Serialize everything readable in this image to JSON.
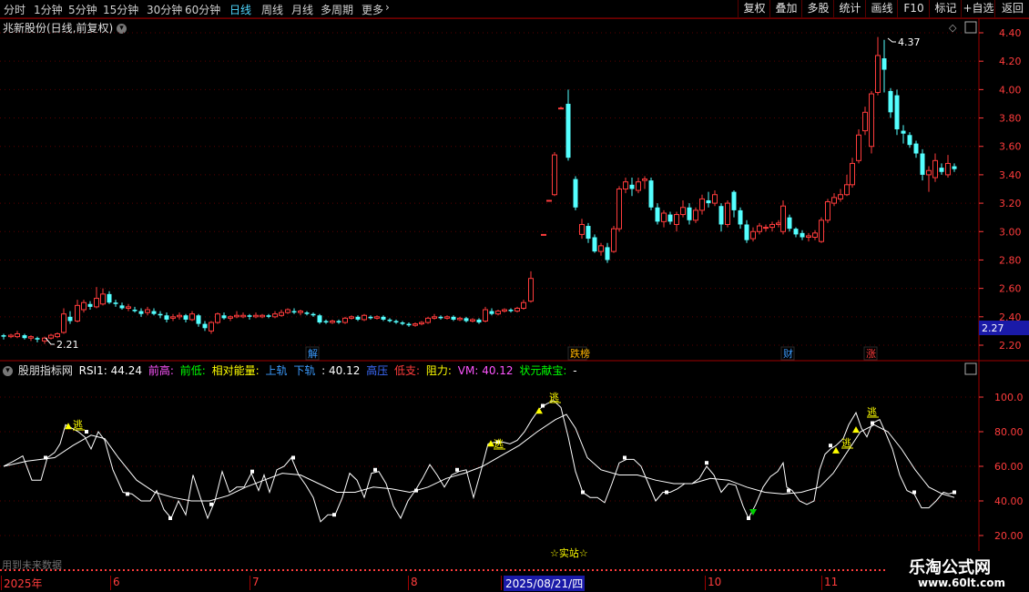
{
  "topbar": {
    "tabs": [
      {
        "label": "分时",
        "active": false
      },
      {
        "label": "1分钟",
        "active": false
      },
      {
        "label": "5分钟",
        "active": false
      },
      {
        "label": "15分钟",
        "active": false
      },
      {
        "label": "30分钟",
        "active": false
      },
      {
        "label": "60分钟",
        "active": false
      },
      {
        "label": "日线",
        "active": true
      },
      {
        "label": "周线",
        "active": false
      },
      {
        "label": "月线",
        "active": false
      },
      {
        "label": "多周期",
        "active": false
      },
      {
        "label": "更多",
        "active": false
      }
    ],
    "buttons": [
      "复权",
      "叠加",
      "多股",
      "统计",
      "画线",
      "F10",
      "标记",
      "+自选",
      "返回"
    ]
  },
  "stock": {
    "title": "兆新股份(日线,前复权)"
  },
  "price_axis": {
    "labels": [
      "4.40",
      "4.20",
      "4.00",
      "3.80",
      "3.60",
      "3.40",
      "3.20",
      "3.00",
      "2.80",
      "2.60",
      "2.40",
      "2.20"
    ],
    "current": "2.27"
  },
  "price_annotations": {
    "high": "4.37",
    "low": "2.21"
  },
  "event_markers": [
    "解",
    "跌榜",
    "财",
    "涨"
  ],
  "indicator": {
    "name": "股朋指标网",
    "rsi1": "RSI1: 44.24",
    "qiangao": "前高:",
    "qiandi": "前低:",
    "energy": "相对能量:",
    "upper": "上轨",
    "lower": "下轨",
    "val1": ": 40.12",
    "gaoya": "高压",
    "dizhi": "低支:",
    "zuli": "阻力:",
    "vm": "VM: 40.12",
    "zhuangyuan": "状元献宝:",
    "dash": "-",
    "axis_labels": [
      "100.0",
      "80.00",
      "60.00",
      "40.00",
      "20.00"
    ],
    "escape_label": "逃",
    "station_label": "☆实站☆"
  },
  "footer": {
    "left_text": "用到未来数据",
    "dates": [
      "2025年",
      "6",
      "7",
      "8",
      "2025/08/21/四",
      "10",
      "11"
    ],
    "watermark_title": "乐淘公式网",
    "watermark_url": "www.60lt.com"
  },
  "colors": {
    "up": "#ff3c3c",
    "down": "#54ffff",
    "axis": "#ff3c3c",
    "white": "#ffffff",
    "yellow": "#ffff00",
    "green": "#00d000"
  }
}
